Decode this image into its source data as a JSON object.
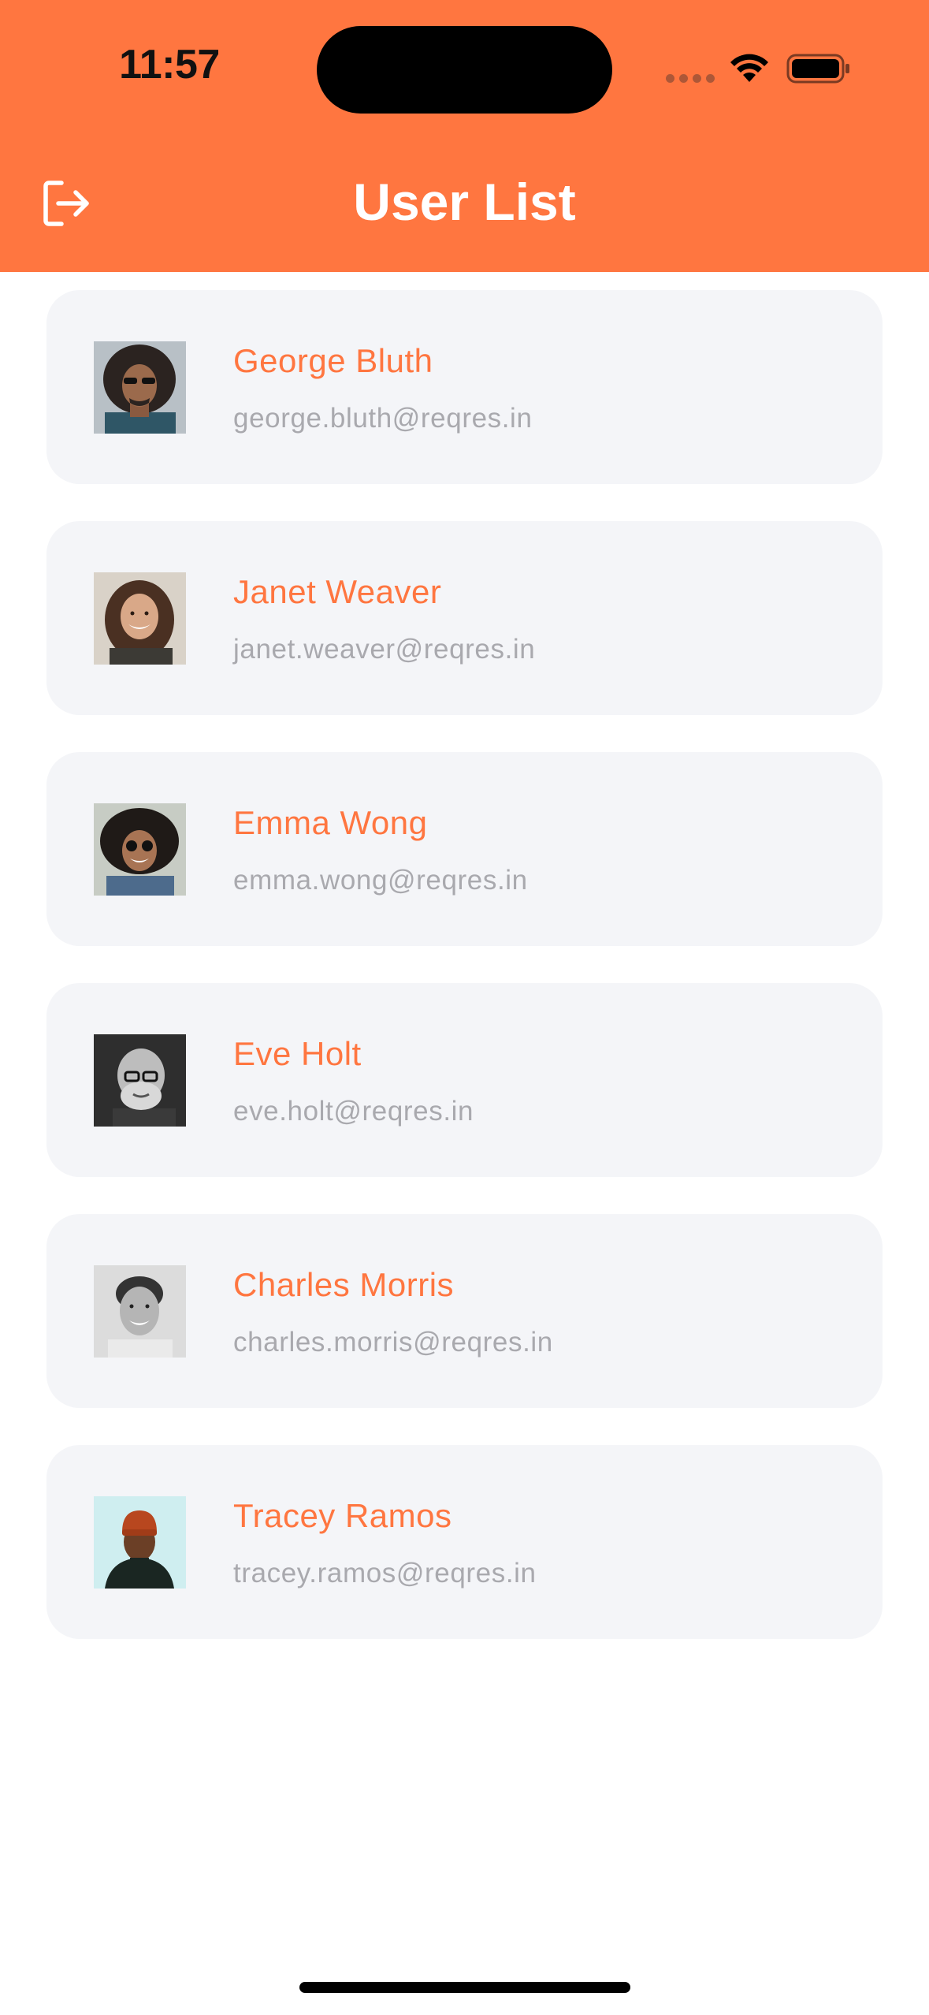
{
  "status_bar": {
    "time": "11:57"
  },
  "header": {
    "title": "User List",
    "logout_icon": "logout-icon",
    "background_color": "#FF7640"
  },
  "users": [
    {
      "name": "George Bluth",
      "email": "george.bluth@reqres.in"
    },
    {
      "name": "Janet Weaver",
      "email": "janet.weaver@reqres.in"
    },
    {
      "name": "Emma Wong",
      "email": "emma.wong@reqres.in"
    },
    {
      "name": "Eve Holt",
      "email": "eve.holt@reqres.in"
    },
    {
      "name": "Charles Morris",
      "email": "charles.morris@reqres.in"
    },
    {
      "name": "Tracey Ramos",
      "email": "tracey.ramos@reqres.in"
    }
  ],
  "colors": {
    "accent": "#FF7640",
    "card_background": "#F4F5F8",
    "email_text": "#A9A9AE"
  }
}
